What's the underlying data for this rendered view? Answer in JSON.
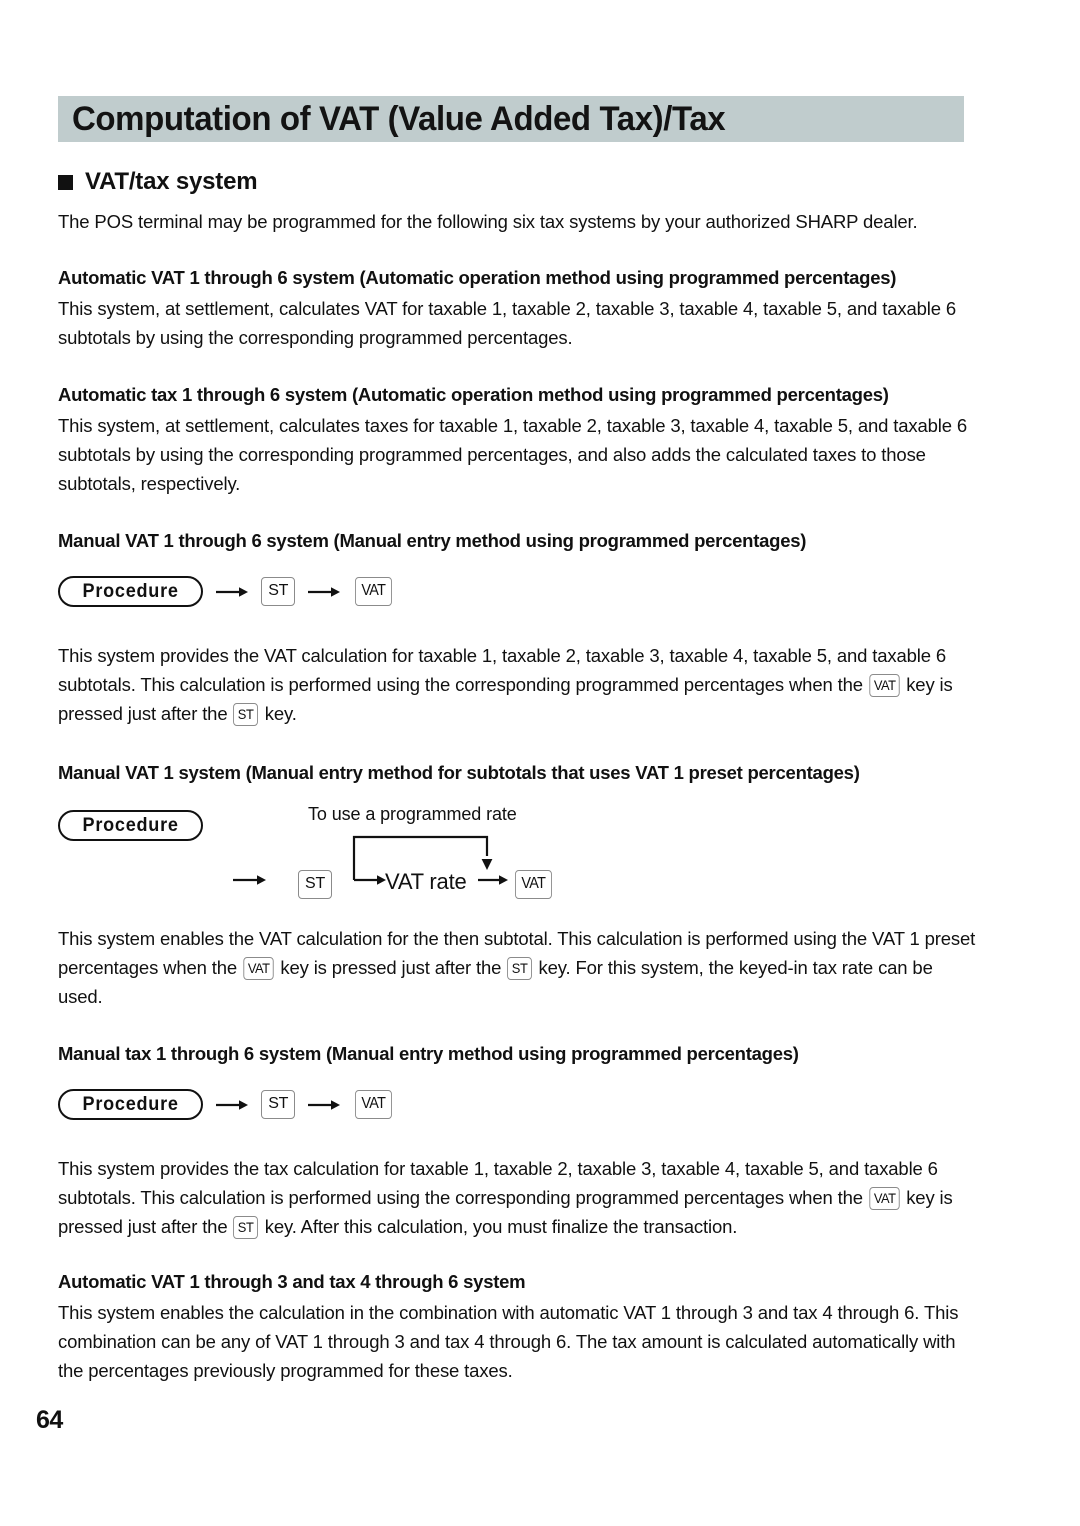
{
  "page": {
    "title": "Computation of VAT (Value Added Tax)/Tax",
    "page_number": "64",
    "banner_color": "#c0cccd"
  },
  "section": {
    "bullet_heading": "VAT/tax system",
    "intro": "The POS terminal may be programmed for the following six tax systems by your authorized SHARP dealer."
  },
  "blocks": {
    "auto_vat": {
      "heading": "Automatic VAT 1 through 6 system (Automatic operation method using programmed percentages)",
      "body": "This system, at settlement, calculates VAT for taxable 1, taxable 2, taxable 3, taxable 4, taxable 5, and taxable 6 subtotals by using the corresponding programmed percentages."
    },
    "auto_tax": {
      "heading": "Automatic tax 1 through 6 system (Automatic operation method using programmed percentages)",
      "body": "This system, at settlement, calculates taxes for taxable 1, taxable 2, taxable 3, taxable 4, taxable 5, and taxable 6 subtotals by using the corresponding programmed percentages, and also adds the calculated taxes to those subtotals, respectively."
    },
    "manual_vat_6": {
      "heading": "Manual VAT 1 through 6 system (Manual entry method using programmed percentages)",
      "body_1": "This system provides the VAT calculation for taxable 1, taxable 2, taxable 3, taxable 4, taxable 5, and taxable 6 subtotals. This calculation is performed using the corresponding programmed percentages when the ",
      "body_2": " key is pressed just after the ",
      "body_3": " key."
    },
    "manual_vat_1": {
      "heading": "Manual VAT 1 system (Manual entry method for subtotals that uses VAT 1 preset percentages)",
      "diagram_note": "To use a programmed rate",
      "diagram_rate_label": "VAT rate",
      "body_1": "This system enables the VAT calculation for the then subtotal. This calculation is performed using the VAT 1 preset percentages when the ",
      "body_2": " key is pressed just after the ",
      "body_3": " key. For this system, the keyed-in tax rate can be used."
    },
    "manual_tax_6": {
      "heading": "Manual tax 1 through 6 system (Manual entry method using programmed percentages)",
      "body_1": "This system provides the tax calculation for taxable 1, taxable 2, taxable 3, taxable 4, taxable 5, and taxable 6 subtotals. This calculation is performed using the corresponding programmed percentages when the ",
      "body_2": " key is pressed just after the ",
      "body_3": " key. After this calculation, you must finalize the transaction."
    },
    "auto_combo": {
      "heading": "Automatic VAT 1 through 3 and tax 4 through 6 system",
      "body": "This system enables the calculation in the combination with automatic VAT 1 through 3 and tax 4 through 6. This combination can be any of VAT 1 through 3 and tax 4 through 6. The tax amount is calculated automatically with the percentages previously programmed for these taxes."
    }
  },
  "keys": {
    "procedure_label": "Procedure",
    "st": "ST",
    "vat": "VAT"
  }
}
